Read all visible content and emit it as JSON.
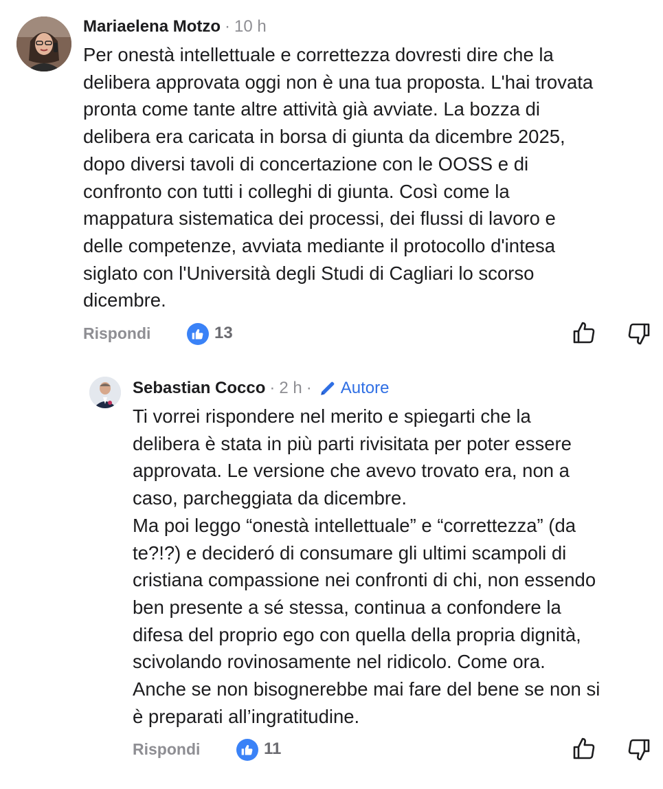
{
  "comments": [
    {
      "author": "Mariaelena Motzo",
      "separator": "·",
      "time": "10 h",
      "text_lines": [
        "Per onestà intellettuale e correttezza dovresti dire che la",
        "delibera approvata oggi non è una tua proposta. L'hai trovata",
        "pronta come tante altre attività già avviate. La bozza di",
        "delibera era caricata in borsa di giunta da dicembre 2025,",
        "dopo diversi tavoli di concertazione con le OOSS e di",
        "confronto con tutti i colleghi di giunta. Così come la",
        "mappatura sistematica dei processi, dei flussi di lavoro e",
        "delle competenze, avviata mediante il protocollo d'intesa",
        "siglato con l'Università degli Studi di Cagliari lo scorso",
        "dicembre."
      ],
      "reply_label": "Rispondi",
      "like_count": "13"
    },
    {
      "author": "Sebastian Cocco",
      "separator": "·",
      "time": "2 h",
      "author_badge": "Autore",
      "text_lines": [
        "Ti vorrei rispondere nel merito e spiegarti che la",
        "delibera è stata in più parti rivisitata per poter essere",
        "approvata. Le versione che avevo trovato era, non a",
        "caso, parcheggiata da dicembre.",
        "Ma poi leggo  “onestà intellettuale” e “correttezza” (da",
        "te?!?) e decideró di consumare gli ultimi scampoli di",
        "cristiana compassione nei confronti di chi, non essendo",
        "ben presente a sé stessa, continua a confondere la",
        "difesa del proprio ego con quella della propria dignità,",
        "scivolando rovinosamente nel ridicolo. Come ora.",
        "Anche se non bisognerebbe mai fare del bene se non si",
        "è preparati all’ingratitudine."
      ],
      "reply_label": "Rispondi",
      "like_count": "11"
    }
  ],
  "icons": {
    "like_badge": "thumbs-up-icon",
    "like_action": "thumbs-up-outline-icon",
    "dislike_action": "thumbs-down-outline-icon",
    "author_badge": "pencil-icon"
  },
  "colors": {
    "accent": "#3a82f7",
    "author_badge": "#2f6fe4",
    "muted": "#8e8e93",
    "text": "#1c1c1e"
  }
}
